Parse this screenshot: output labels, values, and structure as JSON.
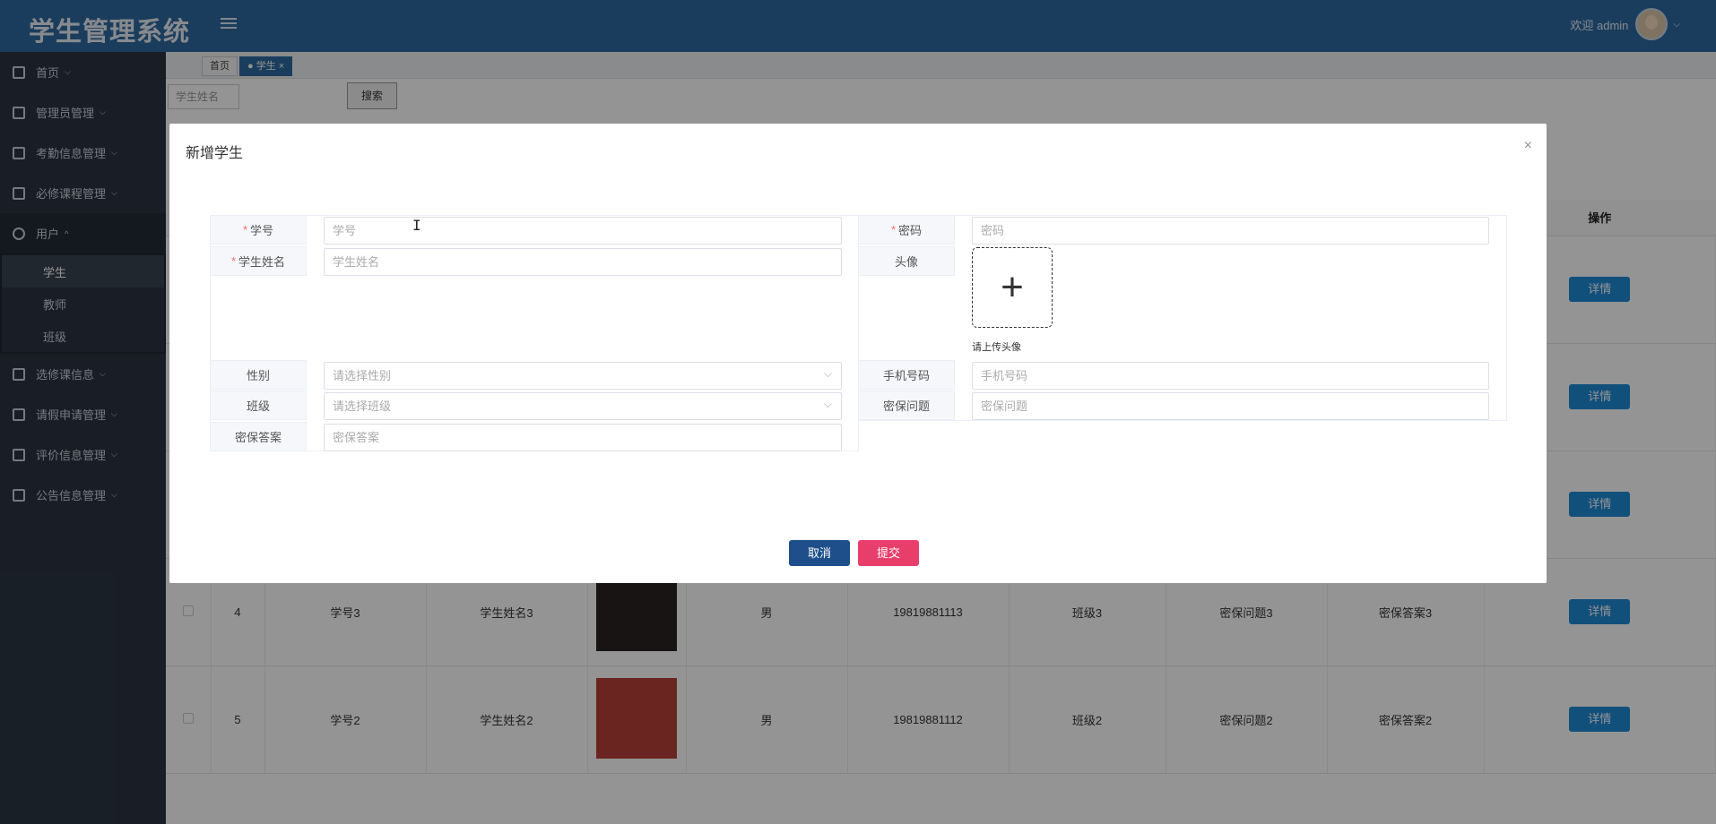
{
  "app": {
    "title": "学生管理系统",
    "welcome": "欢迎 admin"
  },
  "sidebar": {
    "items": [
      {
        "label": "首页",
        "icon": "home-icon"
      },
      {
        "label": "管理员管理",
        "icon": "admin-icon"
      },
      {
        "label": "考勤信息管理",
        "icon": "grid-icon"
      },
      {
        "label": "必修课程管理",
        "icon": "chip-icon"
      },
      {
        "label": "用户",
        "icon": "user-icon"
      },
      {
        "label": "选修课信息",
        "icon": "apps-icon"
      },
      {
        "label": "请假申请管理",
        "icon": "car-icon"
      },
      {
        "label": "评价信息管理",
        "icon": "table-icon"
      },
      {
        "label": "公告信息管理",
        "icon": "store-icon"
      }
    ],
    "user_sub": [
      "学生",
      "教师",
      "班级"
    ]
  },
  "tabs": {
    "home": "首页",
    "student": "● 学生"
  },
  "search": {
    "placeholder": "学生姓名",
    "button": "搜索"
  },
  "table": {
    "op_header": "操作",
    "detail_label": "详情",
    "rows": [
      {
        "idx": "",
        "no": "",
        "name": "",
        "gender": "",
        "phone": "",
        "cls": "",
        "q": "",
        "a": ""
      },
      {
        "idx": "",
        "no": "",
        "name": "",
        "gender": "",
        "phone": "",
        "cls": "",
        "q": "",
        "a": ""
      },
      {
        "idx": "",
        "no": "",
        "name": "",
        "gender": "",
        "phone": "",
        "cls": "",
        "q": "",
        "a": ""
      },
      {
        "idx": "4",
        "no": "学号3",
        "name": "学生姓名3",
        "gender": "男",
        "phone": "19819881113",
        "cls": "班级3",
        "q": "密保问题3",
        "a": "密保答案3"
      },
      {
        "idx": "5",
        "no": "学号2",
        "name": "学生姓名2",
        "gender": "男",
        "phone": "19819881112",
        "cls": "班级2",
        "q": "密保问题2",
        "a": "密保答案2"
      }
    ]
  },
  "modal": {
    "title": "新增学生",
    "close": "×",
    "fields": {
      "student_no": {
        "label": "学号",
        "placeholder": "学号"
      },
      "password": {
        "label": "密码",
        "placeholder": "密码"
      },
      "student_name": {
        "label": "学生姓名",
        "placeholder": "学生姓名"
      },
      "avatar": {
        "label": "头像",
        "tip": "请上传头像"
      },
      "gender": {
        "label": "性别",
        "placeholder": "请选择性别"
      },
      "phone": {
        "label": "手机号码",
        "placeholder": "手机号码"
      },
      "class": {
        "label": "班级",
        "placeholder": "请选择班级"
      },
      "question": {
        "label": "密保问题",
        "placeholder": "密保问题"
      },
      "answer": {
        "label": "密保答案",
        "placeholder": "密保答案"
      }
    },
    "cancel": "取消",
    "submit": "提交"
  },
  "colors": {
    "header": "#2f6aa0",
    "sidebar": "#2b3543",
    "detail_button": "#1f8ad6",
    "cancel_button": "#1e4f8a",
    "submit_button": "#e83e6c"
  }
}
